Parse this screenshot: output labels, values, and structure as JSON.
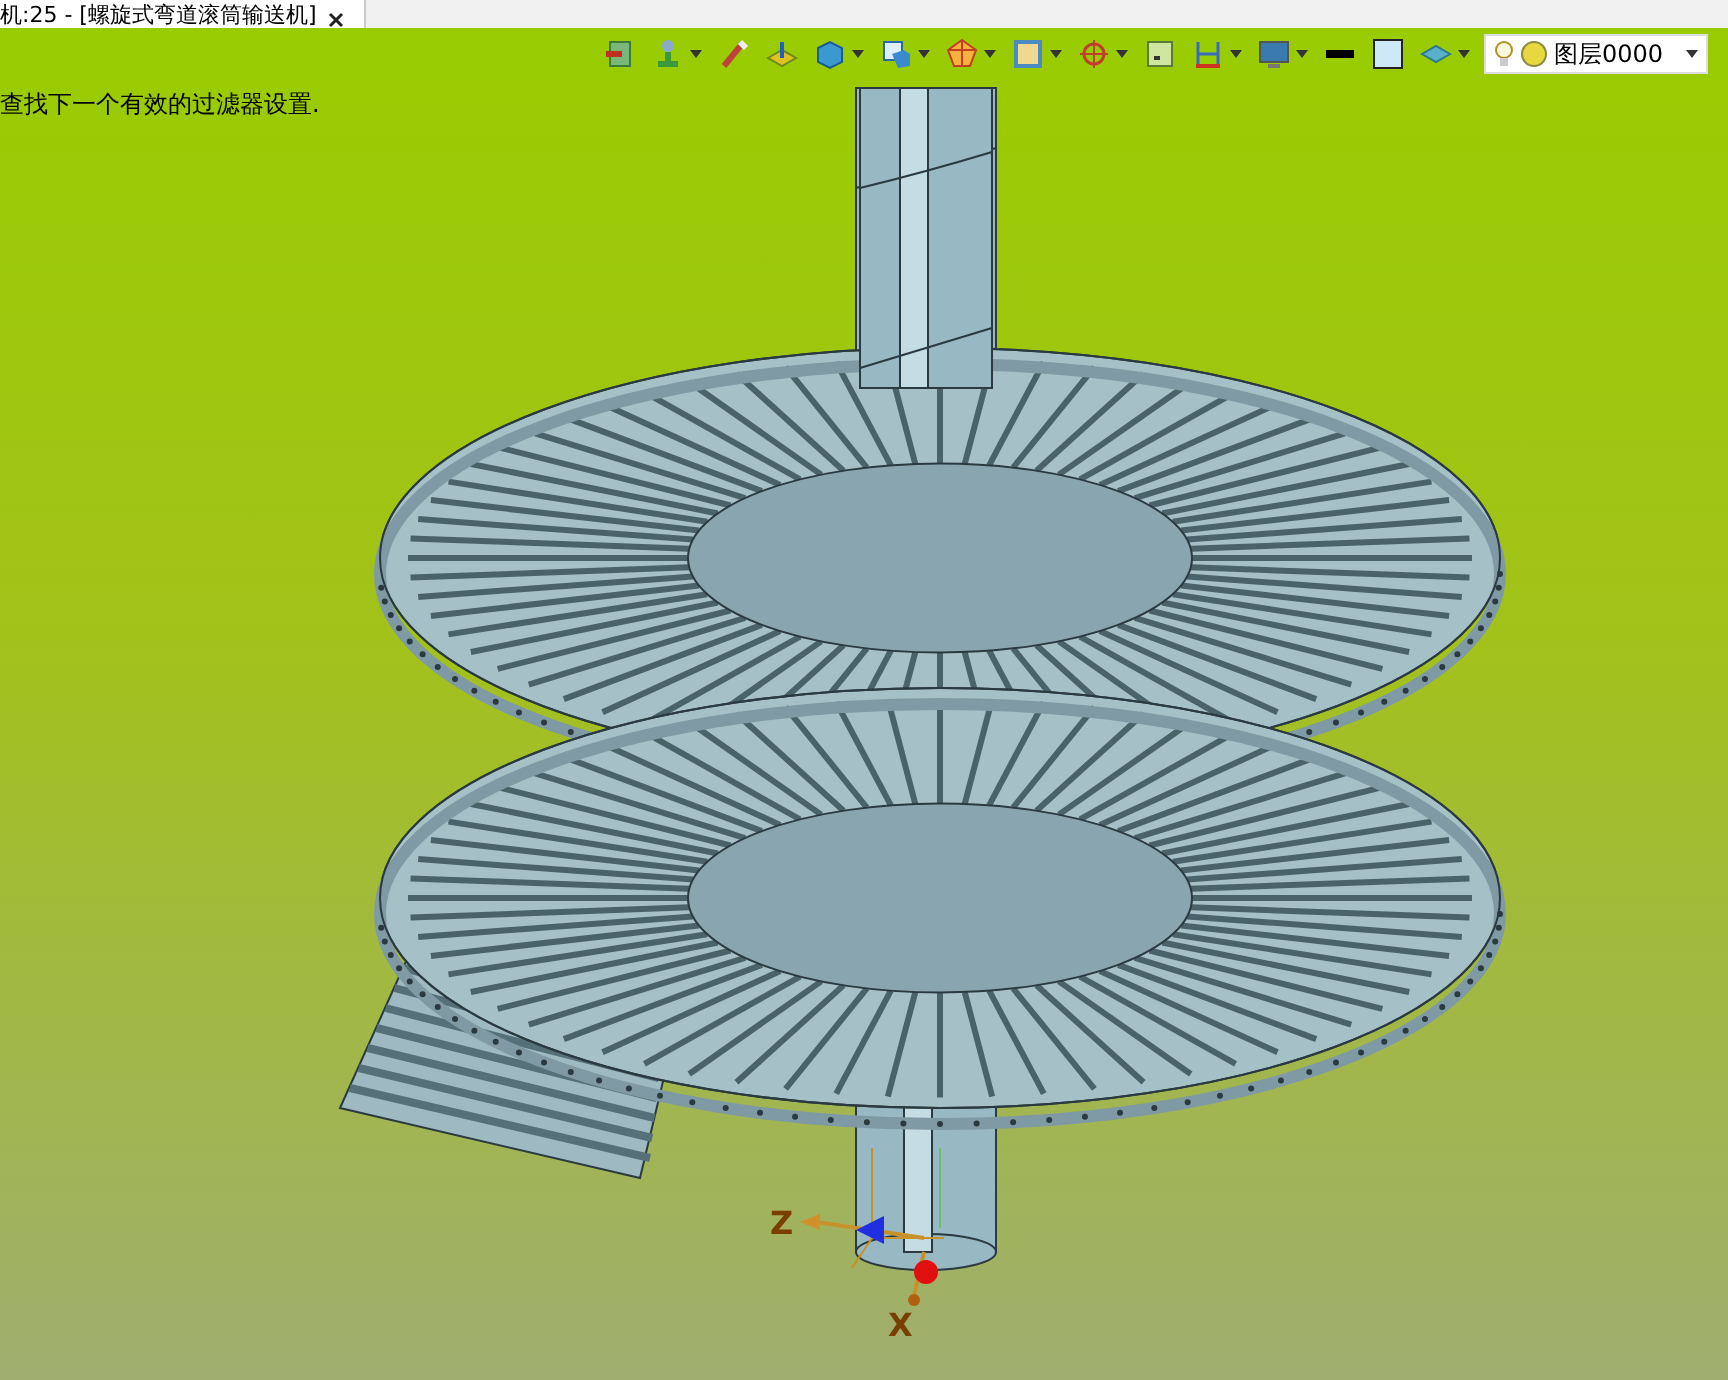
{
  "tab": {
    "title": "机:25 - [螺旋式弯道滚筒输送机]"
  },
  "toolbar": {
    "items": [
      {
        "has_menu": false
      },
      {
        "has_menu": true
      },
      {
        "has_menu": false
      },
      {
        "has_menu": false
      },
      {
        "has_menu": true
      },
      {
        "has_menu": true
      },
      {
        "has_menu": true
      },
      {
        "has_menu": true
      },
      {
        "has_menu": true
      },
      {
        "has_menu": false
      },
      {
        "has_menu": true
      },
      {
        "has_menu": true
      },
      {
        "has_menu": false
      },
      {
        "has_menu": false
      },
      {
        "has_menu": true
      }
    ],
    "layer_select": {
      "value": "图层0000"
    }
  },
  "status_message": "查找下一个有效的过滤器设置.",
  "axes": [
    {
      "label": "Z"
    },
    {
      "label": "X"
    }
  ]
}
